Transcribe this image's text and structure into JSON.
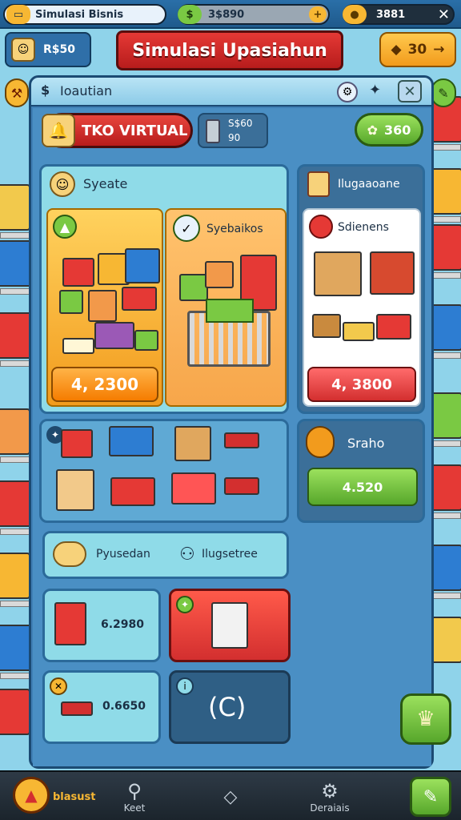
{
  "topbar": {
    "pill1_label": "Simulasi Bisnis",
    "pill2_value": "3$890",
    "pill3_value": "3881"
  },
  "row2": {
    "left_value": "R$50",
    "title": "Simulasi Upasiahun",
    "right_value": "30"
  },
  "panel": {
    "header_title": "Ioautian",
    "shop_banner": "TKO VIRTUAL",
    "coins_top": "S$60",
    "coins_bottom": "90",
    "green_value": "360",
    "cat1_label": "Syeate",
    "cat2_label": "Ilugaaoane",
    "tile1_price": "4, 2300",
    "tile2_label": "Syebaikos",
    "tile3_label": "Sdienens",
    "tile3_price": "4, 3800",
    "sraho_label": "Sraho",
    "sraho_value": "4.520",
    "bottom_label1": "Pyusedan",
    "bottom_label2": "Ilugsetree",
    "small1_price": "6.2980",
    "small3_price": "0.6650",
    "small4_symbol": "(C)"
  },
  "bottomnav": {
    "item1": "blasust",
    "item2": "Keet",
    "item3": "",
    "item4": "Deraiais"
  },
  "colors": {
    "orange": "#f7b733",
    "red": "#e53935",
    "green": "#7ac943",
    "teal": "#8fdbe8"
  }
}
